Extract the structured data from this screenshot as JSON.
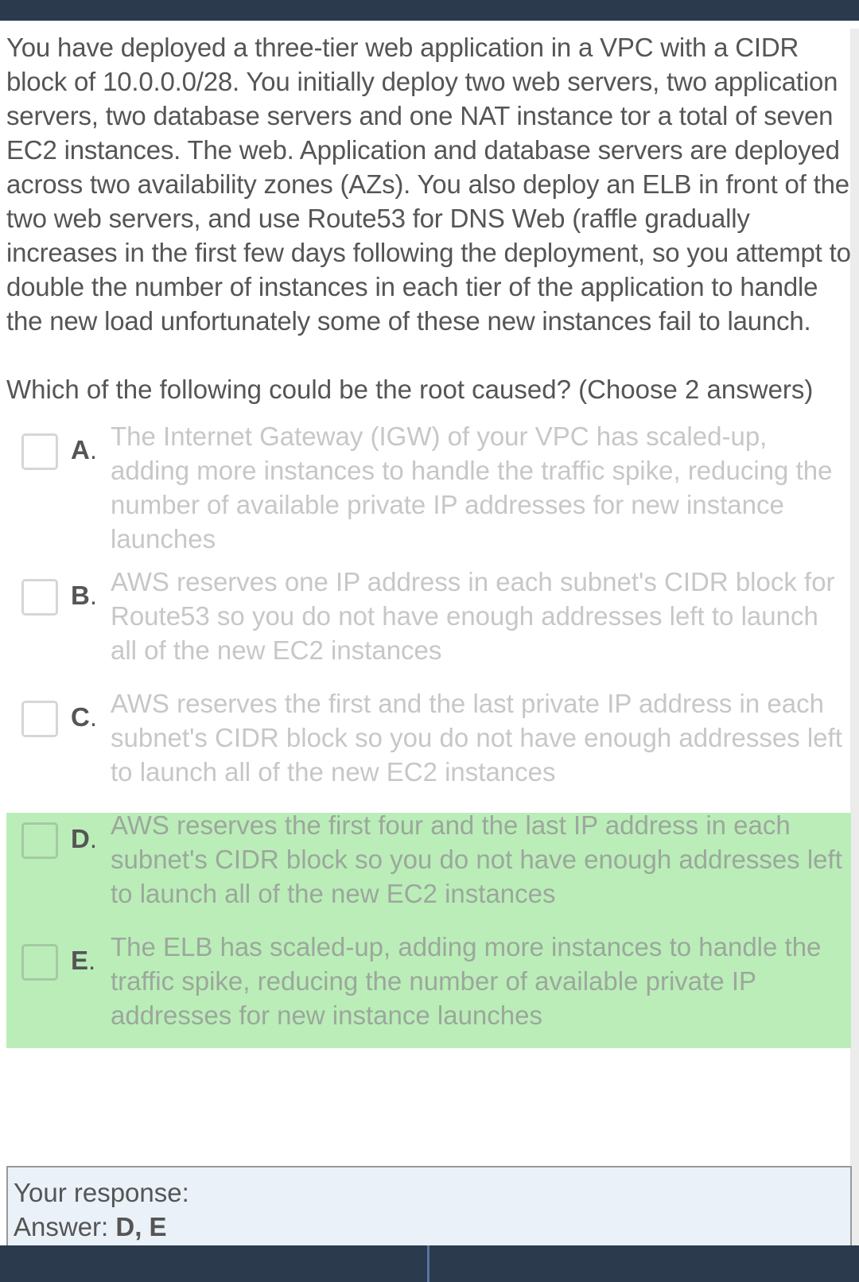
{
  "question": {
    "text": "You have deployed a three-tier web application in a VPC with a CIDR block of 10.0.0.0/28. You initially deploy two web servers, two application servers, two database servers and one NAT instance tor a total of seven EC2 instances. The web. Application and database servers are deployed across two availability zones (AZs). You also deploy an ELB in front of the two web servers, and use Route53 for DNS Web (raffle gradually increases in the first few days following the deployment, so you attempt to double the number of instances in each tier of the application to handle the new load unfortunately some of these new instances fail to launch.",
    "prompt": "Which of the following could be the root caused? (Choose 2 answers)"
  },
  "options": [
    {
      "letter": "A",
      "text": "The Internet Gateway (IGW) of your VPC has scaled-up, adding more instances to handle the traffic spike, reducing the number of available private IP addresses for new instance launches"
    },
    {
      "letter": "B",
      "text": "AWS reserves one IP address in each subnet's CIDR block for Route53 so you do not have enough addresses left to launch all of the new EC2 instances"
    },
    {
      "letter": "C",
      "text": "AWS reserves the first and the last private IP address in each subnet's CIDR block so you do not have enough addresses left to launch all of the new EC2 instances"
    },
    {
      "letter": "D",
      "text": "AWS reserves the first four and the last IP address in each subnet's CIDR block so you do not have enough addresses left to launch all of the new EC2 instances"
    },
    {
      "letter": "E",
      "text": "The ELB has scaled-up, adding more instances to handle the traffic spike, reducing the number of available private IP addresses for new instance launches"
    }
  ],
  "response": {
    "label": "Your response:",
    "answer_label": "Answer:",
    "answer_value": "D, E"
  },
  "colors": {
    "header_bar": "#2b3a4c",
    "correct_highlight": "#bbedb9",
    "response_bg": "#eaf1f9"
  }
}
